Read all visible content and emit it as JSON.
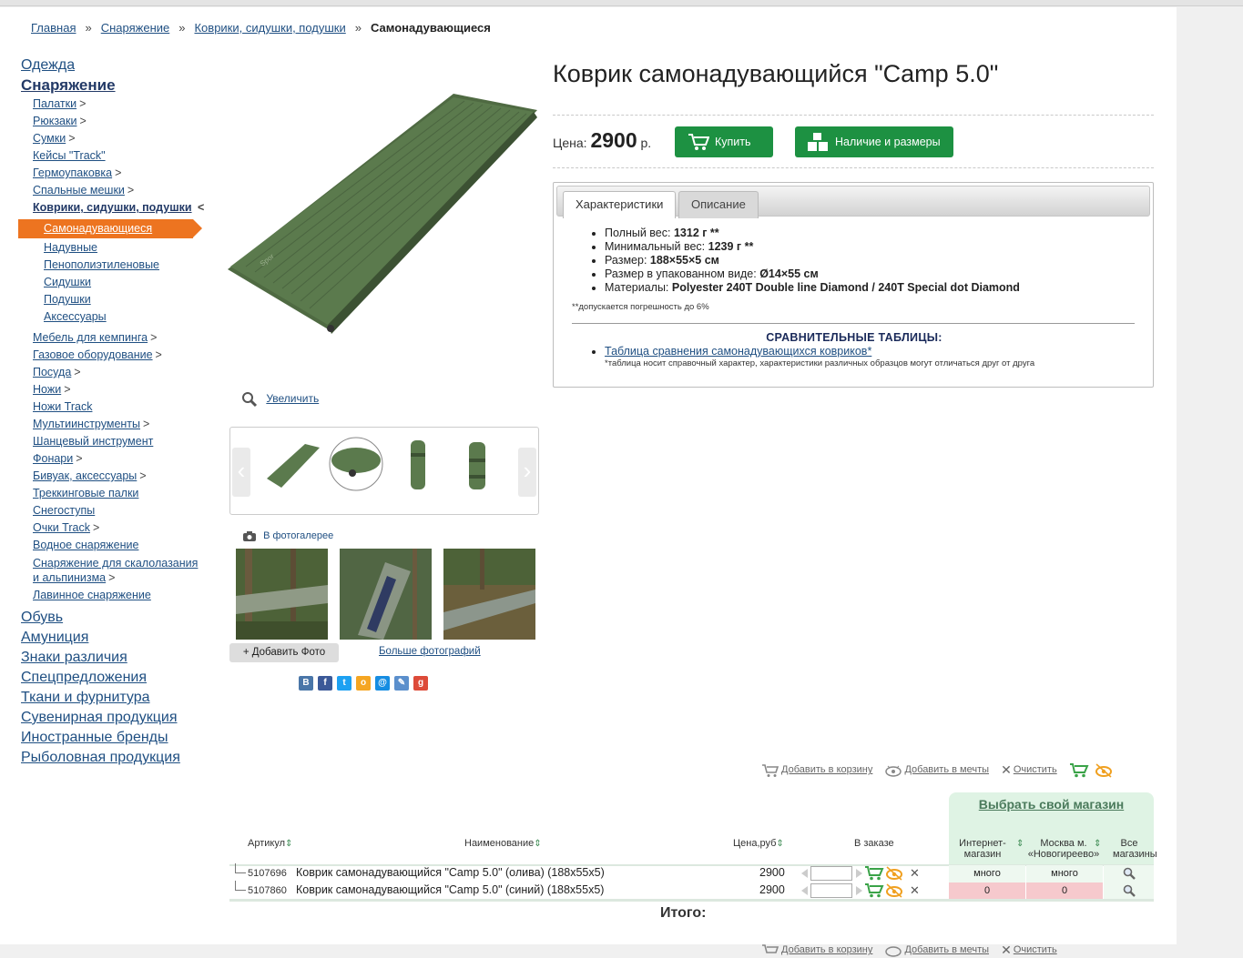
{
  "breadcrumb": [
    "Главная",
    "Снаряжение",
    "Коврики, сидушки, подушки",
    "Самонадувающиеся"
  ],
  "breadcrumb_sep": "»",
  "sidebar": {
    "top": [
      "Одежда",
      "Снаряжение"
    ],
    "sub_before": [
      {
        "label": "Палатки",
        "gt": ">"
      },
      {
        "label": "Рюкзаки",
        "gt": ">"
      },
      {
        "label": "Сумки",
        "gt": ">"
      },
      {
        "label": "Кейсы \"Track\"",
        "gt": ""
      },
      {
        "label": "Гермоупаковка",
        "gt": ">"
      },
      {
        "label": "Спальные мешки",
        "gt": ">"
      }
    ],
    "active_sub": "Коврики, сидушки, подушки",
    "active_gt": "<",
    "subsub": [
      "Самонадувающиеся",
      "Надувные",
      "Пенополиэтиленовые",
      "Сидушки",
      "Подушки",
      "Аксессуары"
    ],
    "sub_after": [
      {
        "label": "Мебель для кемпинга",
        "gt": ">"
      },
      {
        "label": "Газовое оборудование",
        "gt": ">"
      },
      {
        "label": "Посуда",
        "gt": ">"
      },
      {
        "label": "Ножи",
        "gt": ">"
      },
      {
        "label": "Ножи Track",
        "gt": ""
      },
      {
        "label": "Мультиинструменты",
        "gt": ">"
      },
      {
        "label": "Шанцевый инструмент",
        "gt": ""
      },
      {
        "label": "Фонари",
        "gt": ">"
      },
      {
        "label": "Бивуак, аксессуары",
        "gt": ">"
      },
      {
        "label": "Треккинговые палки",
        "gt": ""
      },
      {
        "label": "Снегоступы",
        "gt": ""
      },
      {
        "label": "Очки Track",
        "gt": ">"
      },
      {
        "label": "Водное снаряжение",
        "gt": ""
      },
      {
        "label": "Снаряжение для скалолазания и альпинизма",
        "gt": ">"
      },
      {
        "label": "Лавинное снаряжение",
        "gt": ""
      }
    ],
    "bottom": [
      "Обувь",
      "Амуниция",
      "Знаки различия",
      "Спецпредложения",
      "Ткани и фурнитура",
      "Сувенирная продукция",
      "Иностранные бренды",
      "Рыболовная продукция"
    ]
  },
  "product": {
    "title": "Коврик самонадувающийся \"Camp 5.0\"",
    "price_label": "Цена:",
    "price": "2900",
    "currency": "р.",
    "buy_label": "Купить",
    "avail_label": "Наличие и размеры",
    "zoom_label": "Увеличить",
    "gallery_label": "В фотогалерее",
    "add_photo": "+ Добавить Фото",
    "more_photos": "Больше фотографий"
  },
  "tabs": {
    "active": "Характеристики",
    "inactive": "Описание"
  },
  "specs": [
    {
      "label": "Полный вес:",
      "value": "1312 г **"
    },
    {
      "label": "Минимальный вес:",
      "value": "1239 г **"
    },
    {
      "label": "Размер:",
      "value": "188×55×5 см"
    },
    {
      "label": "Размер в упакованном виде:",
      "value": "Ø14×55 см"
    },
    {
      "label": "Материалы:",
      "value": "Polyester 240T Double line Diamond / 240T Special dot Diamond"
    }
  ],
  "spec_note": "**допускается погрешность до 6%",
  "compare": {
    "title": "СРАВНИТЕЛЬНЫЕ ТАБЛИЦЫ:",
    "link": "Таблица сравнения самонадувающихся ковриков*",
    "note": "*таблица носит справочный характер, характеристики различных образцов могут отличаться друг от друга"
  },
  "cart_tools": {
    "add_cart": "Добавить в корзину",
    "add_dream": "Добавить в мечты",
    "clear": "Очистить"
  },
  "store_select": "Выбрать свой магазин",
  "table": {
    "headers": {
      "article": "Артикул",
      "name": "Наименование",
      "price": "Цена,руб",
      "order": "В заказе",
      "internet": "Интернет-магазин",
      "moscow": "Москва м. «Новогиреево»",
      "all": "Все магазины"
    },
    "rows": [
      {
        "article": "5107696",
        "name": "Коврик самонадувающийся \"Camp 5.0\" (олива) (188x55x5)",
        "price": "2900",
        "internet": "много",
        "moscow": "много"
      },
      {
        "article": "5107860",
        "name": "Коврик самонадувающийся \"Camp 5.0\" (синий) (188x55x5)",
        "price": "2900",
        "internet": "0",
        "moscow": "0"
      }
    ]
  },
  "total_label": "Итого:",
  "colors": {
    "accent_orange": "#ed7420",
    "button_green": "#1d9142",
    "link_blue": "#1f4f82",
    "stock_zero": "#f6c9cd"
  }
}
